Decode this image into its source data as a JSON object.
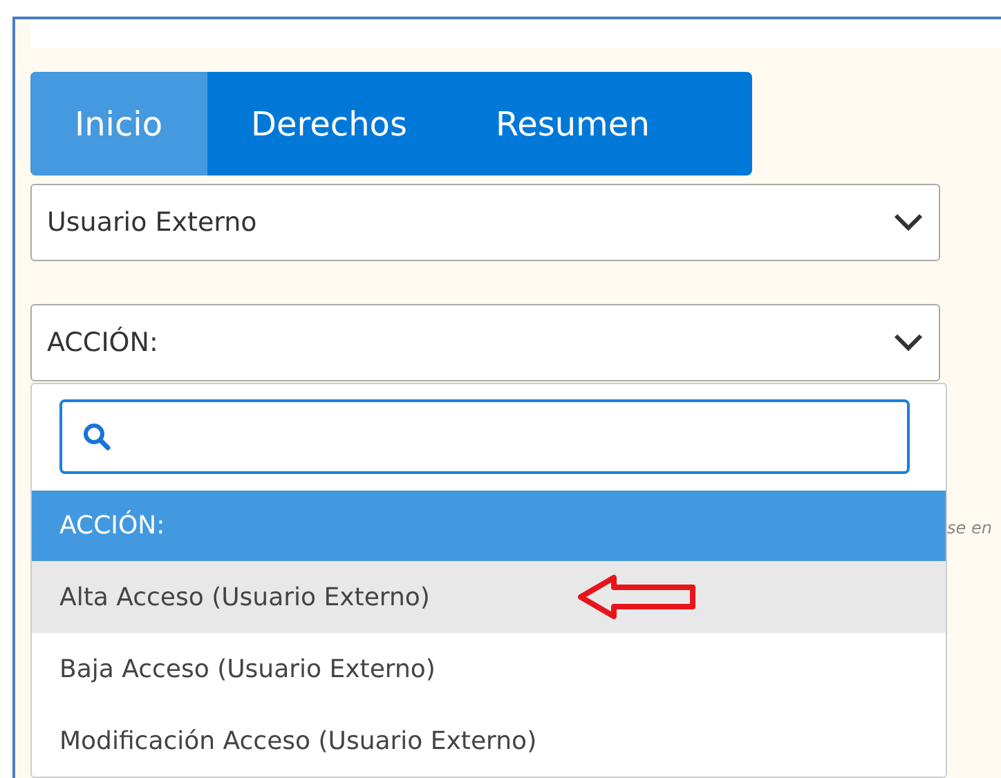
{
  "tabs": [
    {
      "label": "Inicio",
      "selected": true
    },
    {
      "label": "Derechos",
      "selected": false
    },
    {
      "label": "Resumen",
      "selected": false
    }
  ],
  "user_type_select": {
    "value": "Usuario Externo"
  },
  "action_select": {
    "value": "ACCIÓN:",
    "expanded": true
  },
  "background_fragment": "se en",
  "dropdown": {
    "group_header": "ACCIÓN:",
    "options": [
      {
        "label": "Alta Acceso (Usuario Externo)",
        "selected": true,
        "annotated": true
      },
      {
        "label": "Baja Acceso (Usuario Externo)",
        "selected": false,
        "annotated": false
      },
      {
        "label": "Modificación Acceso (Usuario Externo)",
        "selected": false,
        "annotated": false
      }
    ]
  }
}
